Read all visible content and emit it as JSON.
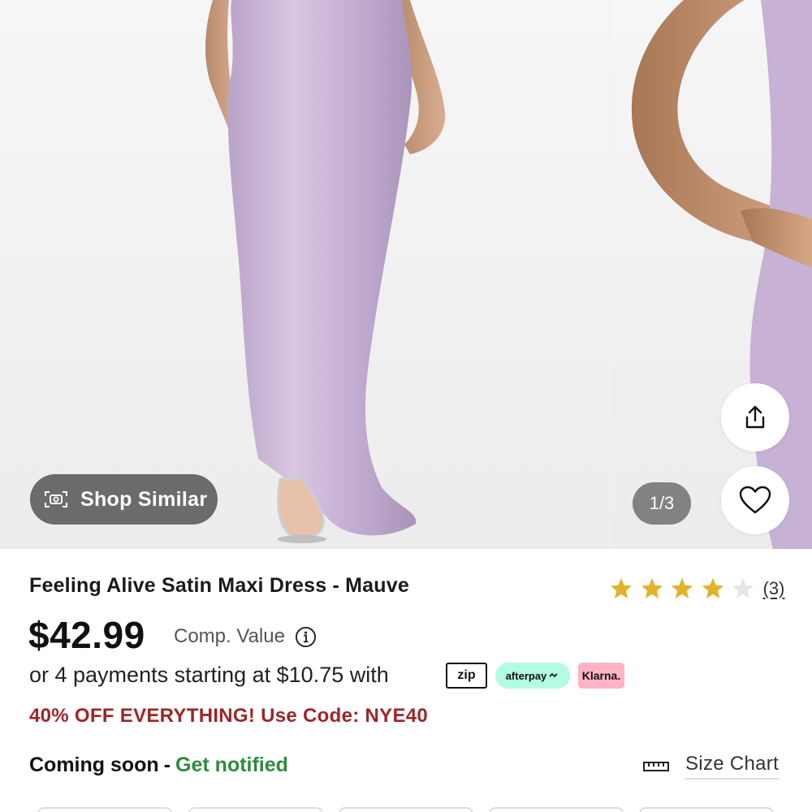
{
  "gallery": {
    "shop_similar_label": "Shop Similar",
    "counter": "1/3",
    "icons": {
      "camera": "camera-scan-icon",
      "share": "share-icon",
      "heart": "heart-icon"
    }
  },
  "product": {
    "title": "Feeling Alive Satin Maxi Dress - Mauve",
    "rating": {
      "stars": 4,
      "max": 5,
      "count_label": "(3)"
    },
    "price": "$42.99",
    "comp_value_label": "Comp. Value",
    "payments_text": "or 4 payments starting at $10.75 with",
    "payment_badges": {
      "zip": "zip",
      "afterpay": "afterpay",
      "klarna": "Klarna."
    },
    "promo": "40% OFF EVERYTHING! Use Code: NYE40",
    "coming_soon": "Coming soon",
    "separator": "-",
    "get_notified": "Get notified",
    "size_chart": "Size Chart"
  },
  "colors": {
    "star_filled": "#e3b22b",
    "star_empty": "#e6e6e6",
    "promo": "#9c2628",
    "notify": "#2e8b3c",
    "dress": "#c9b3d6"
  }
}
